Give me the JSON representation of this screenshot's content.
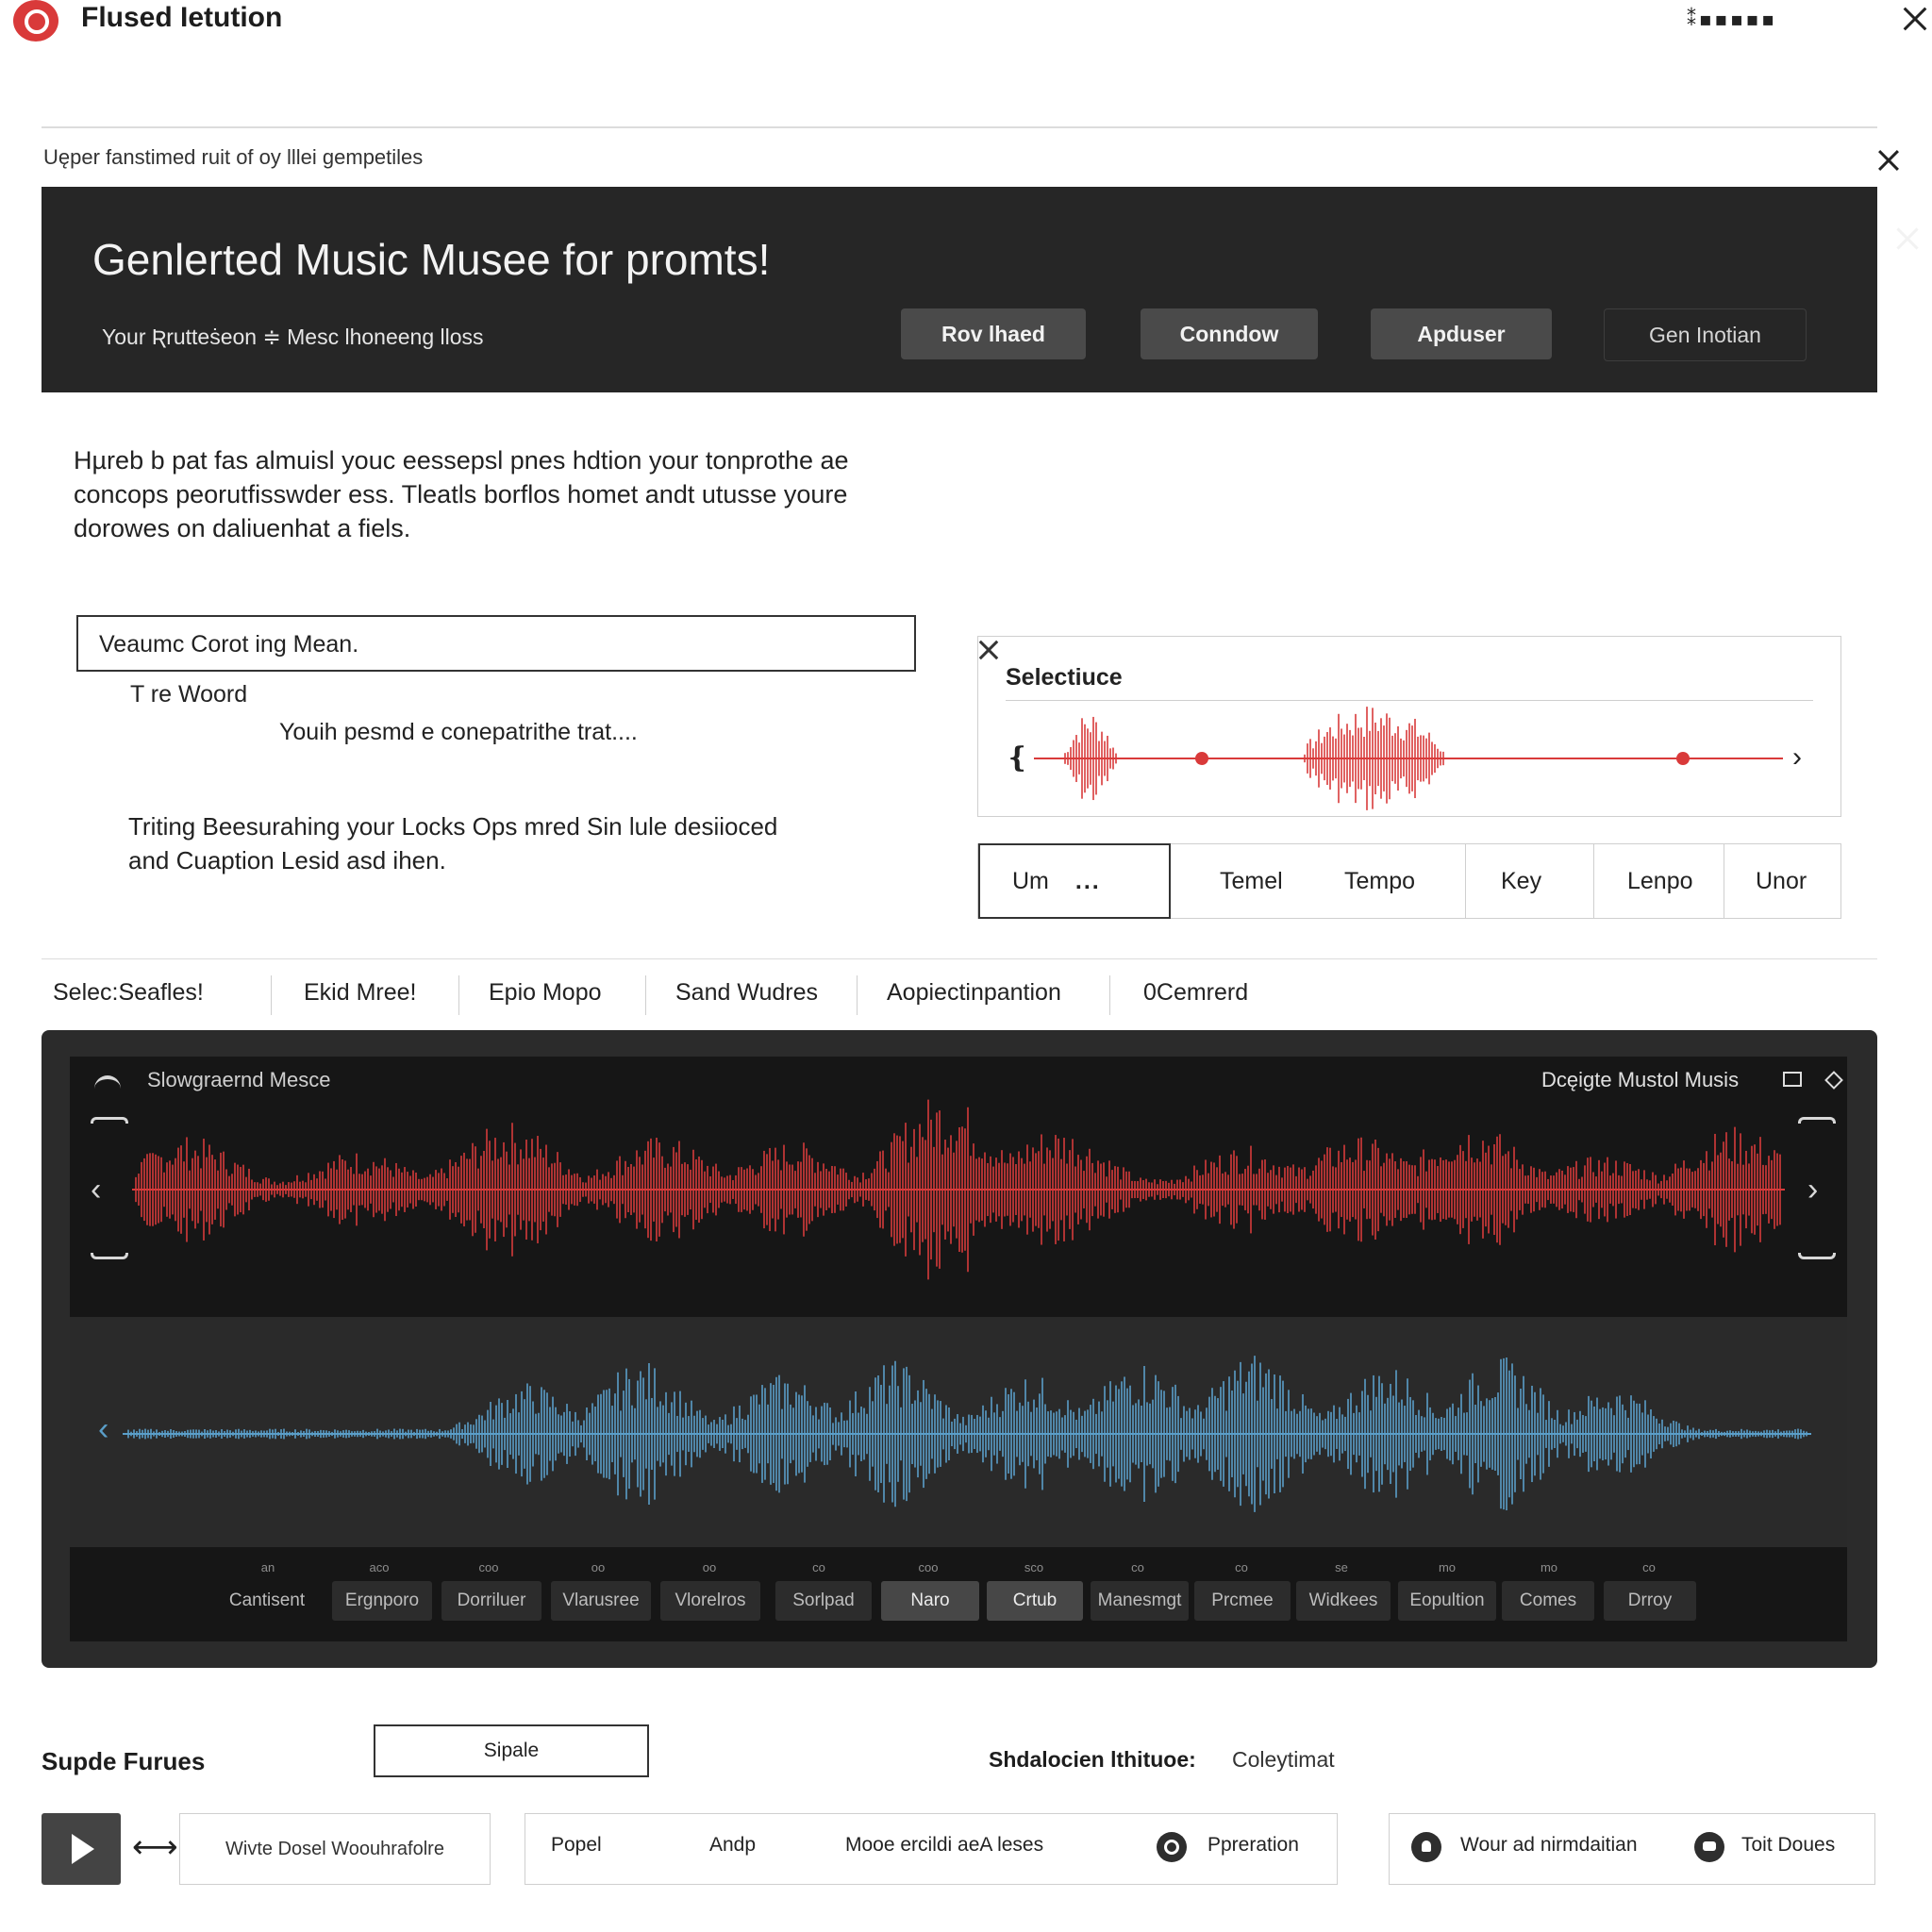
{
  "app": {
    "title": "Flused Ietution",
    "window_controls": "⁑▪▪▪▪▪",
    "close_icon": "close-icon"
  },
  "notice": {
    "text": "Uęper fanstimed ruit of oy lllei gempetiles"
  },
  "banner": {
    "title": "Genlerted Music Musee for promts!",
    "subtitle": "Your Ʀrutteṡeon ≑  Mesc lhoneeng lloss",
    "buttons": [
      "Rov lhaed",
      "Conndow",
      "Apduser",
      "Gen Inotian"
    ]
  },
  "description": "Hµreb b pat fas almuisl youc eessepsl pnes hdtion your tonprothe ae concops peorutfisswder ess. Tleatls borflos homet andt utusse youre dorowes on daliuenhat a fiels.",
  "prompt": {
    "value": "Veaumc Corot ing Mean.",
    "suggestion_1": "T re Woord",
    "suggestion_2": "Youih pesmd e conepatrithe trat....",
    "hint": "Triting Beesurahing your Locks Ops mred Sin lule desiioced and Cuaption Lesid asd ihen."
  },
  "selection": {
    "title": "Selectiuce"
  },
  "params": {
    "first": "Um",
    "first_more": "...",
    "items": [
      "Temel",
      "Tempo",
      "Key",
      "Lenpo",
      "Unor"
    ]
  },
  "tabs": [
    "Selec:Seafles!",
    "Ekid Mree!",
    "Epio Mopo",
    "Sand Wudres",
    "Aopiectinpantion",
    "0Cemrerd"
  ],
  "player": {
    "left_label": "Slowgraernd Mesce",
    "right_label": "Dcęigte Mustol Musis",
    "ticks": [
      "an",
      "aco",
      "coo",
      "oo",
      "oo",
      "co",
      "coo",
      "sco",
      "co",
      "co",
      "se",
      "mo",
      "mo",
      "co"
    ],
    "chips": [
      "Cantisent",
      "Ergnporo",
      "Dorriluer",
      "Vlarusree",
      "Vlorelros",
      "Sorlpad",
      "Naro",
      "Crtub",
      "Manesmgt",
      "Prcmee",
      "Widkees",
      "Eopultion",
      "Comes",
      "Drroy"
    ],
    "active_chips": [
      6,
      7
    ]
  },
  "bottom": {
    "title": "Supde Furues",
    "simple_button": "Sipale",
    "shd_label": "Shdalocien lthituoe:",
    "shd_value": "Coleytimat",
    "box1": "Wivte Dosel Woouhrafolre",
    "box2_items": [
      "Popel",
      "Andp",
      "Mooe ercildi aeA leses",
      "Ppreration"
    ],
    "box3_items": [
      "Wour ad nirmdaitian",
      "Toit Doues"
    ]
  },
  "colors": {
    "accent_red": "#d93a3a",
    "wave_blue": "#5a9ec8",
    "dark_panel": "#262626"
  }
}
